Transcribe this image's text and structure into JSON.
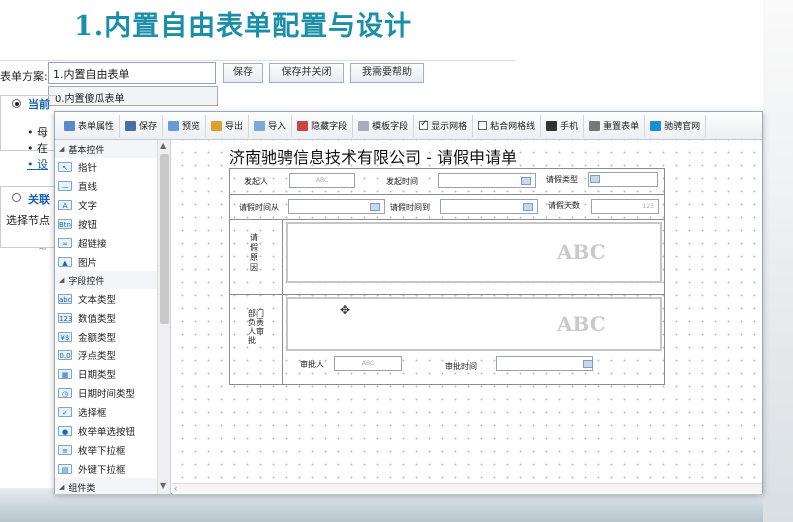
{
  "slide_title": "1.内置自由表单配置与设计",
  "old_dialog": {
    "scheme_label": "表单方案:",
    "scheme_value": "1.内置自由表单",
    "save_btn": "保存",
    "save_close_btn": "保存并关闭",
    "help_btn": "我需要帮助",
    "dropdown_option": "0.内置傻瓜表单",
    "frag_current": "当前",
    "frag_bullet1": "• 母",
    "frag_bullet2": "• 在",
    "frag_bullet3": "• 设",
    "frag_related": "关联",
    "frag_select": "选择节点",
    "frag_tail": "~",
    "accent": "#1a5fb4"
  },
  "toolbar": {
    "items": [
      {
        "label": "表单属性",
        "icon": "form-properties-icon",
        "color": "#5b8bc9"
      },
      {
        "label": "保存",
        "icon": "save-icon",
        "color": "#4a6fa5"
      },
      {
        "label": "预览",
        "icon": "preview-icon",
        "color": "#6c9ad6"
      },
      {
        "label": "导出",
        "icon": "export-icon",
        "color": "#e0a030"
      },
      {
        "label": "导入",
        "icon": "import-icon",
        "color": "#7fa8d8"
      },
      {
        "label": "隐藏字段",
        "icon": "hidden-fields-icon",
        "color": "#c44"
      },
      {
        "label": "模板字段",
        "icon": "template-fields-icon",
        "color": "#aab"
      },
      {
        "label": "显示网格",
        "checkbox": true,
        "checked": true
      },
      {
        "label": "粘合网格线",
        "checkbox": true,
        "checked": false
      },
      {
        "label": "手机",
        "icon": "mobile-icon",
        "color": "#333"
      },
      {
        "label": "重置表单",
        "icon": "reset-form-icon",
        "color": "#777"
      },
      {
        "label": "驰骋官网",
        "icon": "website-icon",
        "color": "#1a8fd6"
      }
    ]
  },
  "sidebar": {
    "groups": [
      {
        "label": "基本控件",
        "items": [
          {
            "label": "指针",
            "icon": "pointer-icon",
            "glyph": "↖"
          },
          {
            "label": "直线",
            "icon": "line-icon",
            "glyph": "—"
          },
          {
            "label": "文字",
            "icon": "text-icon",
            "glyph": "A"
          },
          {
            "label": "按钮",
            "icon": "button-icon",
            "glyph": "Btn"
          },
          {
            "label": "超链接",
            "icon": "hyperlink-icon",
            "glyph": "∞"
          },
          {
            "label": "图片",
            "icon": "image-icon",
            "glyph": "▲"
          }
        ]
      },
      {
        "label": "字段控件",
        "items": [
          {
            "label": "文本类型",
            "icon": "text-type-icon",
            "glyph": "abc"
          },
          {
            "label": "数值类型",
            "icon": "number-type-icon",
            "glyph": "123"
          },
          {
            "label": "金额类型",
            "icon": "money-type-icon",
            "glyph": "¥$"
          },
          {
            "label": "浮点类型",
            "icon": "float-type-icon",
            "glyph": "0.0"
          },
          {
            "label": "日期类型",
            "icon": "date-type-icon",
            "glyph": "▦"
          },
          {
            "label": "日期时间类型",
            "icon": "datetime-type-icon",
            "glyph": "◷"
          },
          {
            "label": "选择框",
            "icon": "checkbox-type-icon",
            "glyph": "✓"
          },
          {
            "label": "枚举单选按钮",
            "icon": "radio-enum-icon",
            "glyph": "●"
          },
          {
            "label": "枚举下拉框",
            "icon": "enum-dropdown-icon",
            "glyph": "≡"
          },
          {
            "label": "外键下拉框",
            "icon": "foreign-key-dropdown-icon",
            "glyph": "▤"
          }
        ]
      },
      {
        "label": "组件类",
        "items": []
      }
    ]
  },
  "form": {
    "title": "济南驰骋信息技术有限公司 - 请假申请单",
    "fields": {
      "applicant_label": "发起人",
      "applicant_value": "ABC",
      "start_time_label": "发起时间",
      "leave_type_label": "请假类型",
      "leave_from_label": "请假时间从",
      "leave_to_label": "请假时间到",
      "leave_days_label": "请假天数",
      "leave_days_value": "123",
      "reason_label": "请假原因",
      "reason_placeholder": "ABC",
      "dept_label": "部门负责人审批",
      "dept_placeholder": "ABC",
      "approver_label": "审批人",
      "approver_value": "ABC",
      "approve_time_label": "审批时间"
    }
  }
}
